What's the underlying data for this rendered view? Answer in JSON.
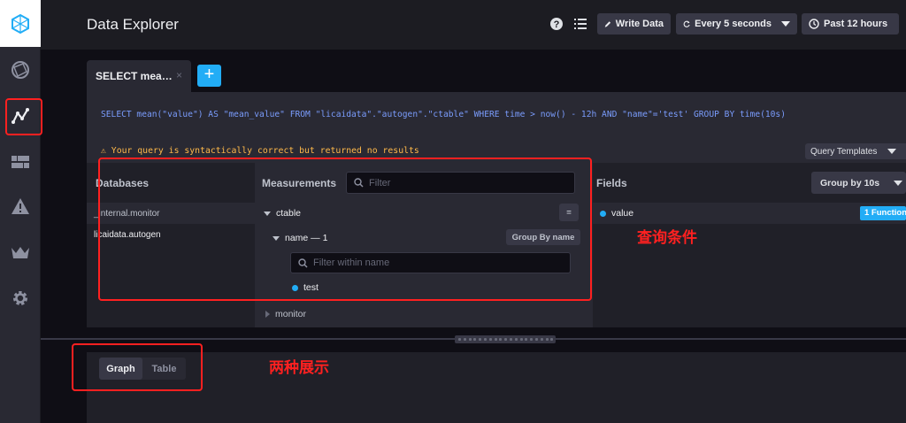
{
  "header": {
    "title": "Data Explorer",
    "write_data": "Write Data",
    "refresh": "Every 5 seconds",
    "time_range": "Past 12 hours"
  },
  "tabs": [
    {
      "label": "SELECT mea…",
      "close": "×"
    }
  ],
  "add_tab": "+",
  "editor": {
    "query": "SELECT mean(\"value\") AS \"mean_value\" FROM \"licaidata\".\"autogen\".\"ctable\" WHERE time > now() - 12h AND \"name\"='test' GROUP BY time(10s)",
    "warning": "⚠ Your query is syntactically correct but returned no results",
    "query_templates": "Query Templates"
  },
  "schema": {
    "databases": {
      "heading": "Databases",
      "items": [
        "_internal.monitor",
        "licaidata.autogen"
      ]
    },
    "measurements": {
      "heading": "Measurements",
      "filter_placeholder": "Filter",
      "tree": {
        "ctable": "ctable",
        "equals_btn": "=",
        "tag_key": "name — 1",
        "group_by_btn": "Group By name",
        "tag_filter_placeholder": "Filter within name",
        "tag_value": "test",
        "monitor": "monitor"
      }
    },
    "fields": {
      "heading": "Fields",
      "group_by": "Group by 10s",
      "items": [
        {
          "label": "value",
          "function": "1 Function"
        }
      ]
    }
  },
  "visualization": {
    "graph": "Graph",
    "table": "Table"
  },
  "annotations": {
    "query_conditions": "查询条件",
    "two_displays": "两种展示"
  },
  "colors": {
    "accent": "#22adf6",
    "warning": "#ffb94a",
    "annotation": "#ff2020",
    "query_text": "#7a9cfc"
  }
}
